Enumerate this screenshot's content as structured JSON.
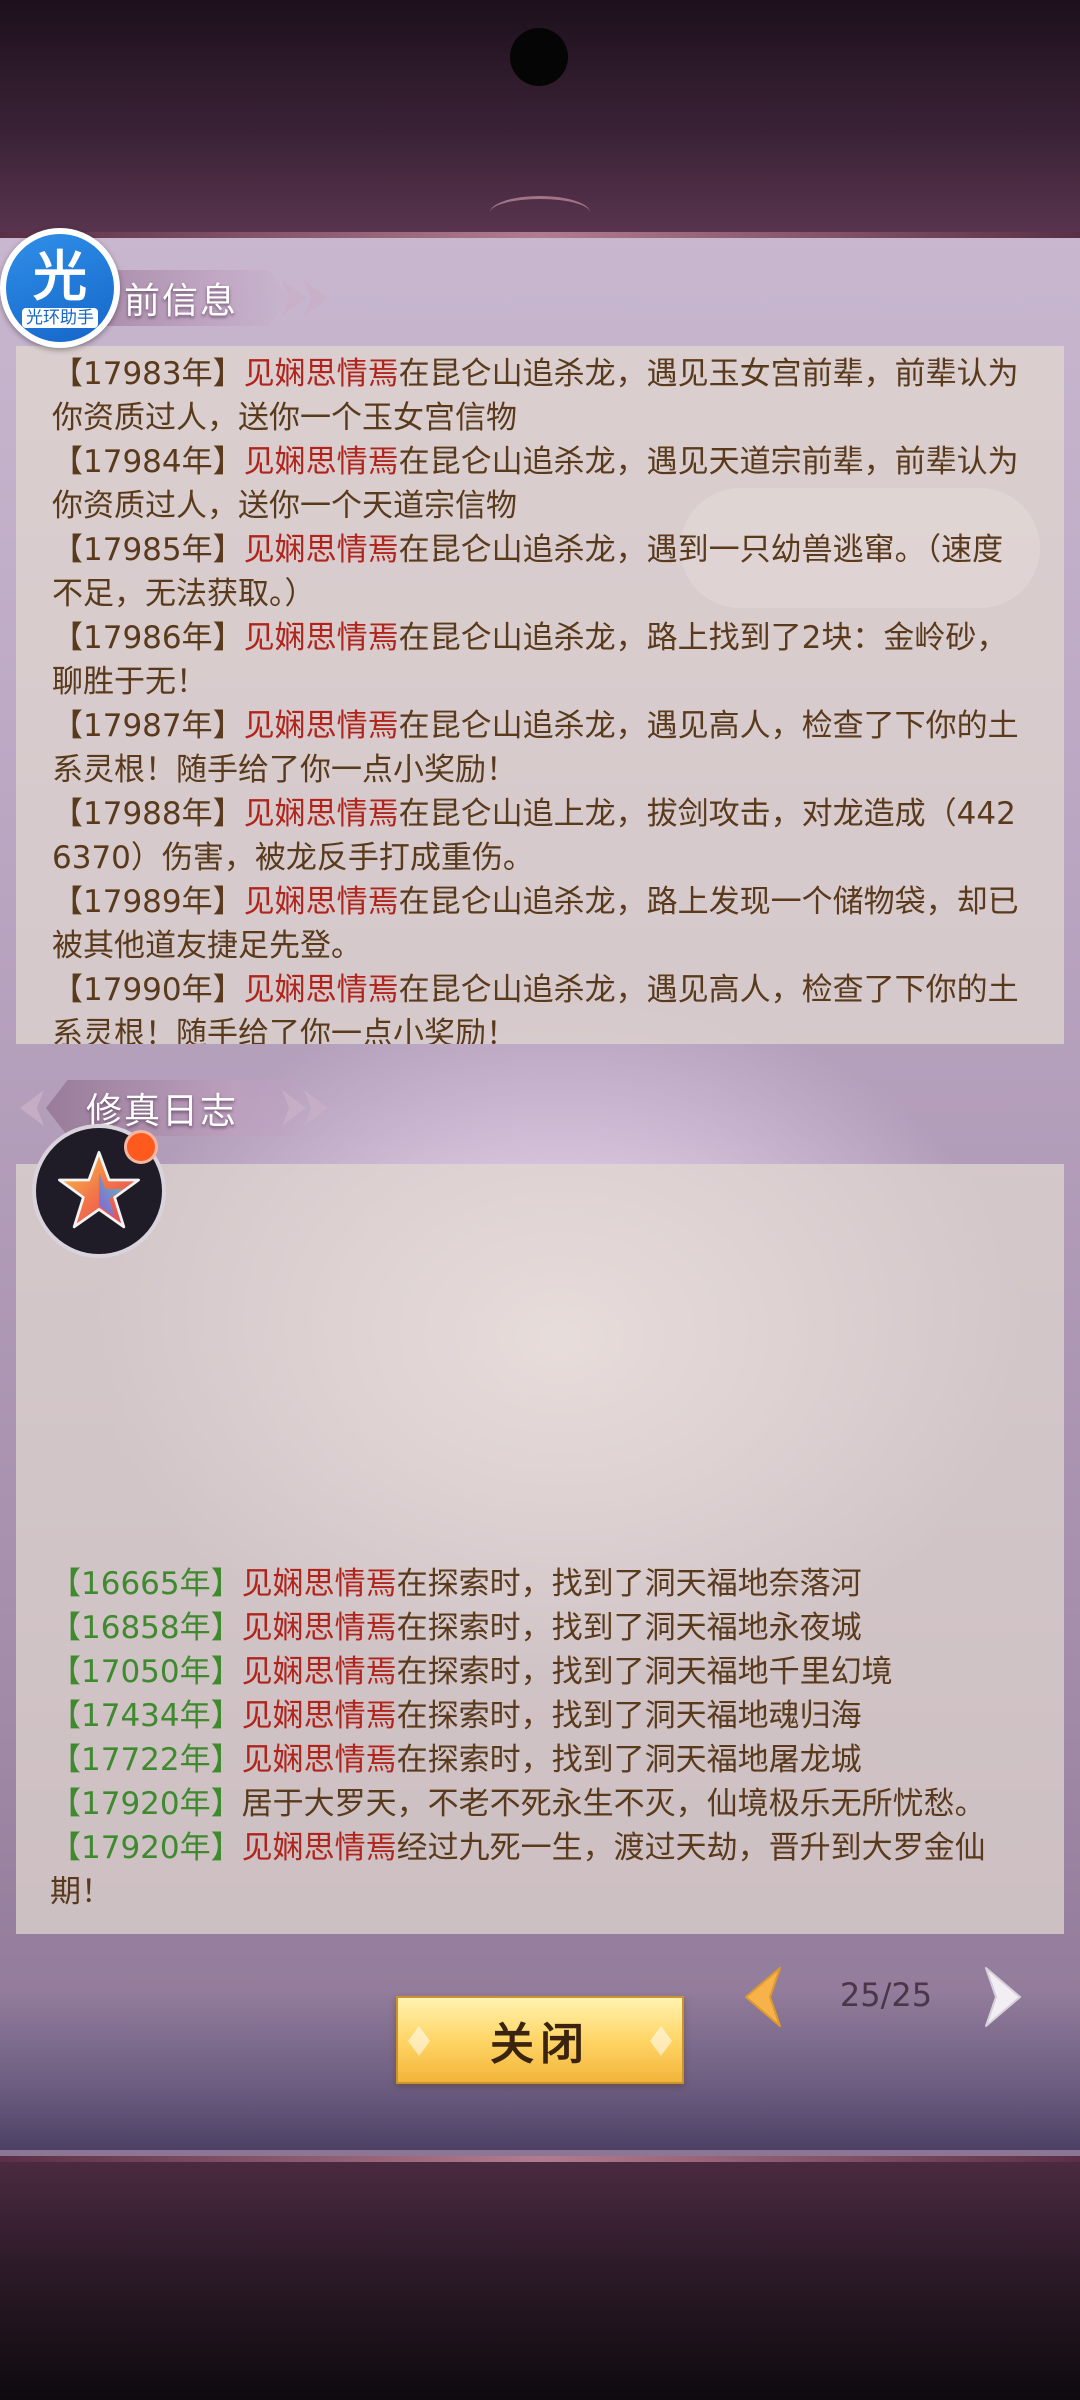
{
  "top_section": {
    "title": "前信息",
    "entries": [
      {
        "year": "【17983年】",
        "name": "见娴思情焉",
        "text": "在昆仑山追杀龙，遇见玉女宫前辈，前辈认为你资质过人，送你一个玉女宫信物"
      },
      {
        "year": "【17984年】",
        "name": "见娴思情焉",
        "text": "在昆仑山追杀龙，遇见天道宗前辈，前辈认为你资质过人，送你一个天道宗信物"
      },
      {
        "year": "【17985年】",
        "name": "见娴思情焉",
        "text": "在昆仑山追杀龙，遇到一只幼兽逃窜。（速度不足，无法获取。）"
      },
      {
        "year": "【17986年】",
        "name": "见娴思情焉",
        "text": "在昆仑山追杀龙，路上找到了2块：金岭砂，聊胜于无！"
      },
      {
        "year": "【17987年】",
        "name": "见娴思情焉",
        "text": "在昆仑山追杀龙，遇见高人，检查了下你的土系灵根！随手给了你一点小奖励！"
      },
      {
        "year": "【17988年】",
        "name": "见娴思情焉",
        "text": "在昆仑山追上龙，拔剑攻击，对龙造成（4426370）伤害，被龙反手打成重伤。"
      },
      {
        "year": "【17989年】",
        "name": "见娴思情焉",
        "text": "在昆仑山追杀龙，路上发现一个储物袋，却已被其他道友捷足先登。"
      },
      {
        "year": "【17990年】",
        "name": "见娴思情焉",
        "text": "在昆仑山追杀龙，遇见高人，检查了下你的土系灵根！随手给了你一点小奖励！"
      }
    ]
  },
  "bottom_section": {
    "title": "修真日志",
    "entries": [
      {
        "year": "【16665年】",
        "name": "见娴思情焉",
        "text": "在探索时，找到了洞天福地奈落河"
      },
      {
        "year": "【16858年】",
        "name": "见娴思情焉",
        "text": "在探索时，找到了洞天福地永夜城"
      },
      {
        "year": "【17050年】",
        "name": "见娴思情焉",
        "text": "在探索时，找到了洞天福地千里幻境"
      },
      {
        "year": "【17434年】",
        "name": "见娴思情焉",
        "text": "在探索时，找到了洞天福地魂归海"
      },
      {
        "year": "【17722年】",
        "name": "见娴思情焉",
        "text": "在探索时，找到了洞天福地屠龙城"
      },
      {
        "year": "【17920年】",
        "name": "",
        "text": "居于大罗天，不老不死永生不灭，仙境极乐无所忧愁。"
      },
      {
        "year": "【17920年】",
        "name": "见娴思情焉",
        "text": "经过九死一生，渡过天劫，晋升到大罗金仙期！"
      }
    ]
  },
  "overlay": {
    "helper_char": "光",
    "helper_label": "光环助手"
  },
  "controls": {
    "close_label": "关闭",
    "page_indicator": "25/25"
  },
  "colors": {
    "year_top": "#5a3a1c",
    "year_bottom": "#3f8a2f",
    "name": "#b0241c",
    "body_text": "#5a3a1c"
  }
}
